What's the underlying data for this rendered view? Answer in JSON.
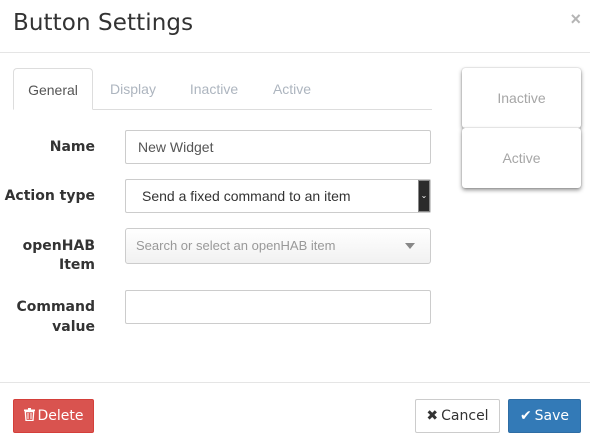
{
  "dialog": {
    "title": "Button Settings",
    "close_label": "×"
  },
  "tabs": [
    {
      "label": "General",
      "active": true
    },
    {
      "label": "Display",
      "active": false
    },
    {
      "label": "Inactive",
      "active": false
    },
    {
      "label": "Active",
      "active": false
    }
  ],
  "form": {
    "name": {
      "label": "Name",
      "value": "New Widget"
    },
    "action_type": {
      "label": "Action type",
      "value": "Send a fixed command to an item"
    },
    "item": {
      "label_line1": "openHAB",
      "label_line2": "Item",
      "placeholder": "Search or select an openHAB item"
    },
    "command": {
      "label_line1": "Command",
      "label_line2": "value",
      "value": ""
    }
  },
  "preview": {
    "inactive_label": "Inactive",
    "active_label": "Active"
  },
  "footer": {
    "delete_label": "Delete",
    "cancel_label": "Cancel",
    "save_label": "Save",
    "delete_icon": "trash-icon",
    "cancel_icon": "times-icon",
    "save_icon": "check-icon"
  },
  "colors": {
    "danger": "#d9534f",
    "primary": "#337ab7",
    "muted_tab": "#adb5bf"
  }
}
